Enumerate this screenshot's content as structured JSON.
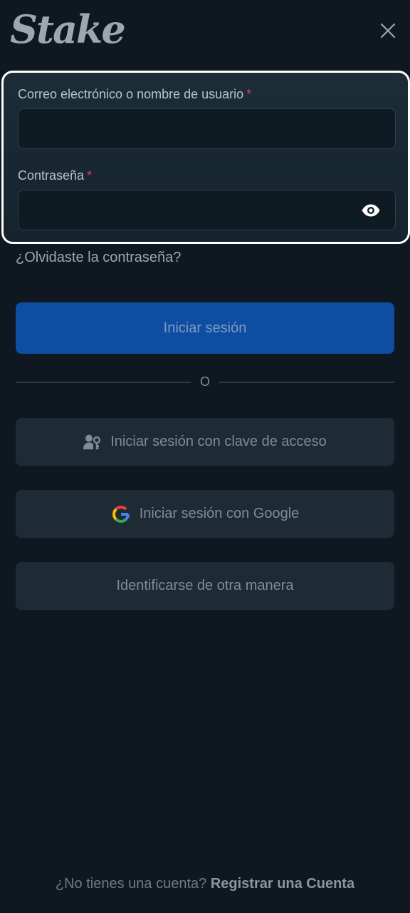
{
  "brand": {
    "logo_text": "Stake"
  },
  "form": {
    "username_label": "Correo electrónico o nombre de usuario",
    "username_required": "*",
    "username_value": "",
    "password_label": "Contraseña",
    "password_required": "*",
    "password_value": ""
  },
  "forgot_password": "¿Olvidaste la contraseña?",
  "buttons": {
    "login": "Iniciar sesión",
    "divider": "O",
    "passkey": "Iniciar sesión con clave de acceso",
    "google": "Iniciar sesión con Google",
    "other": "Identificarse de otra manera"
  },
  "footer": {
    "question": "¿No tienes una cuenta?",
    "register": "Registrar una Cuenta"
  },
  "colors": {
    "background": "#0f1820",
    "login_button": "#0d4ea3",
    "secondary_button": "#1e2b34",
    "required_mark": "#e0405a"
  },
  "icons": [
    "close-icon",
    "eye-icon",
    "passkey-user-icon",
    "google-icon"
  ]
}
